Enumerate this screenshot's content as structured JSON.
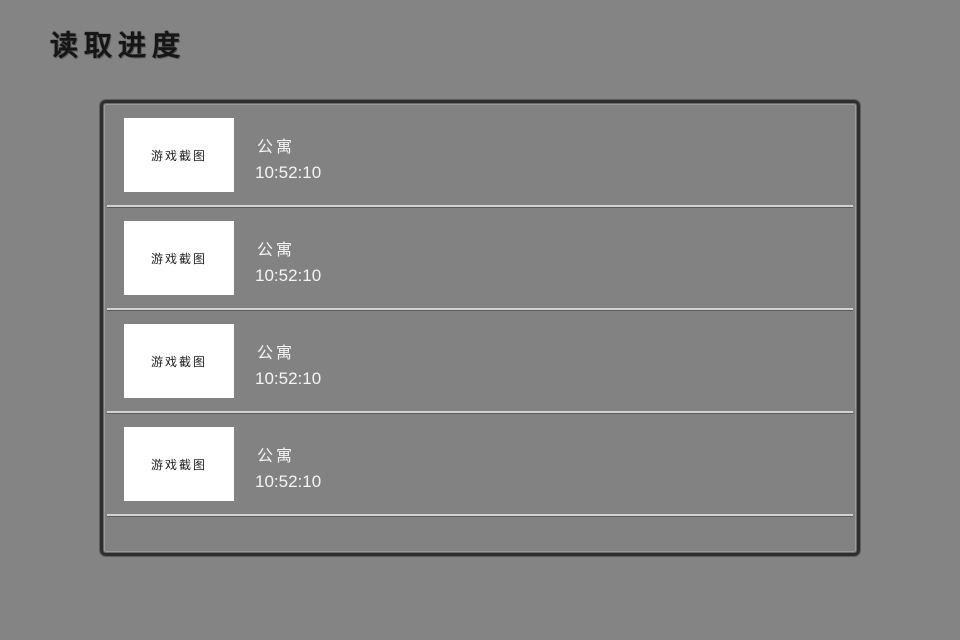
{
  "title": "读取进度",
  "save_slots": [
    {
      "thumbnail_label": "游戏截图",
      "location": "公寓",
      "time": "10:52:10"
    },
    {
      "thumbnail_label": "游戏截图",
      "location": "公寓",
      "time": "10:52:10"
    },
    {
      "thumbnail_label": "游戏截图",
      "location": "公寓",
      "time": "10:52:10"
    },
    {
      "thumbnail_label": "游戏截图",
      "location": "公寓",
      "time": "10:52:10"
    }
  ],
  "colors": {
    "background": "#848484",
    "panel_border": "#2e2e2e",
    "divider": "#d2d2d2",
    "text": "#f4f4f4",
    "title": "#151515"
  }
}
